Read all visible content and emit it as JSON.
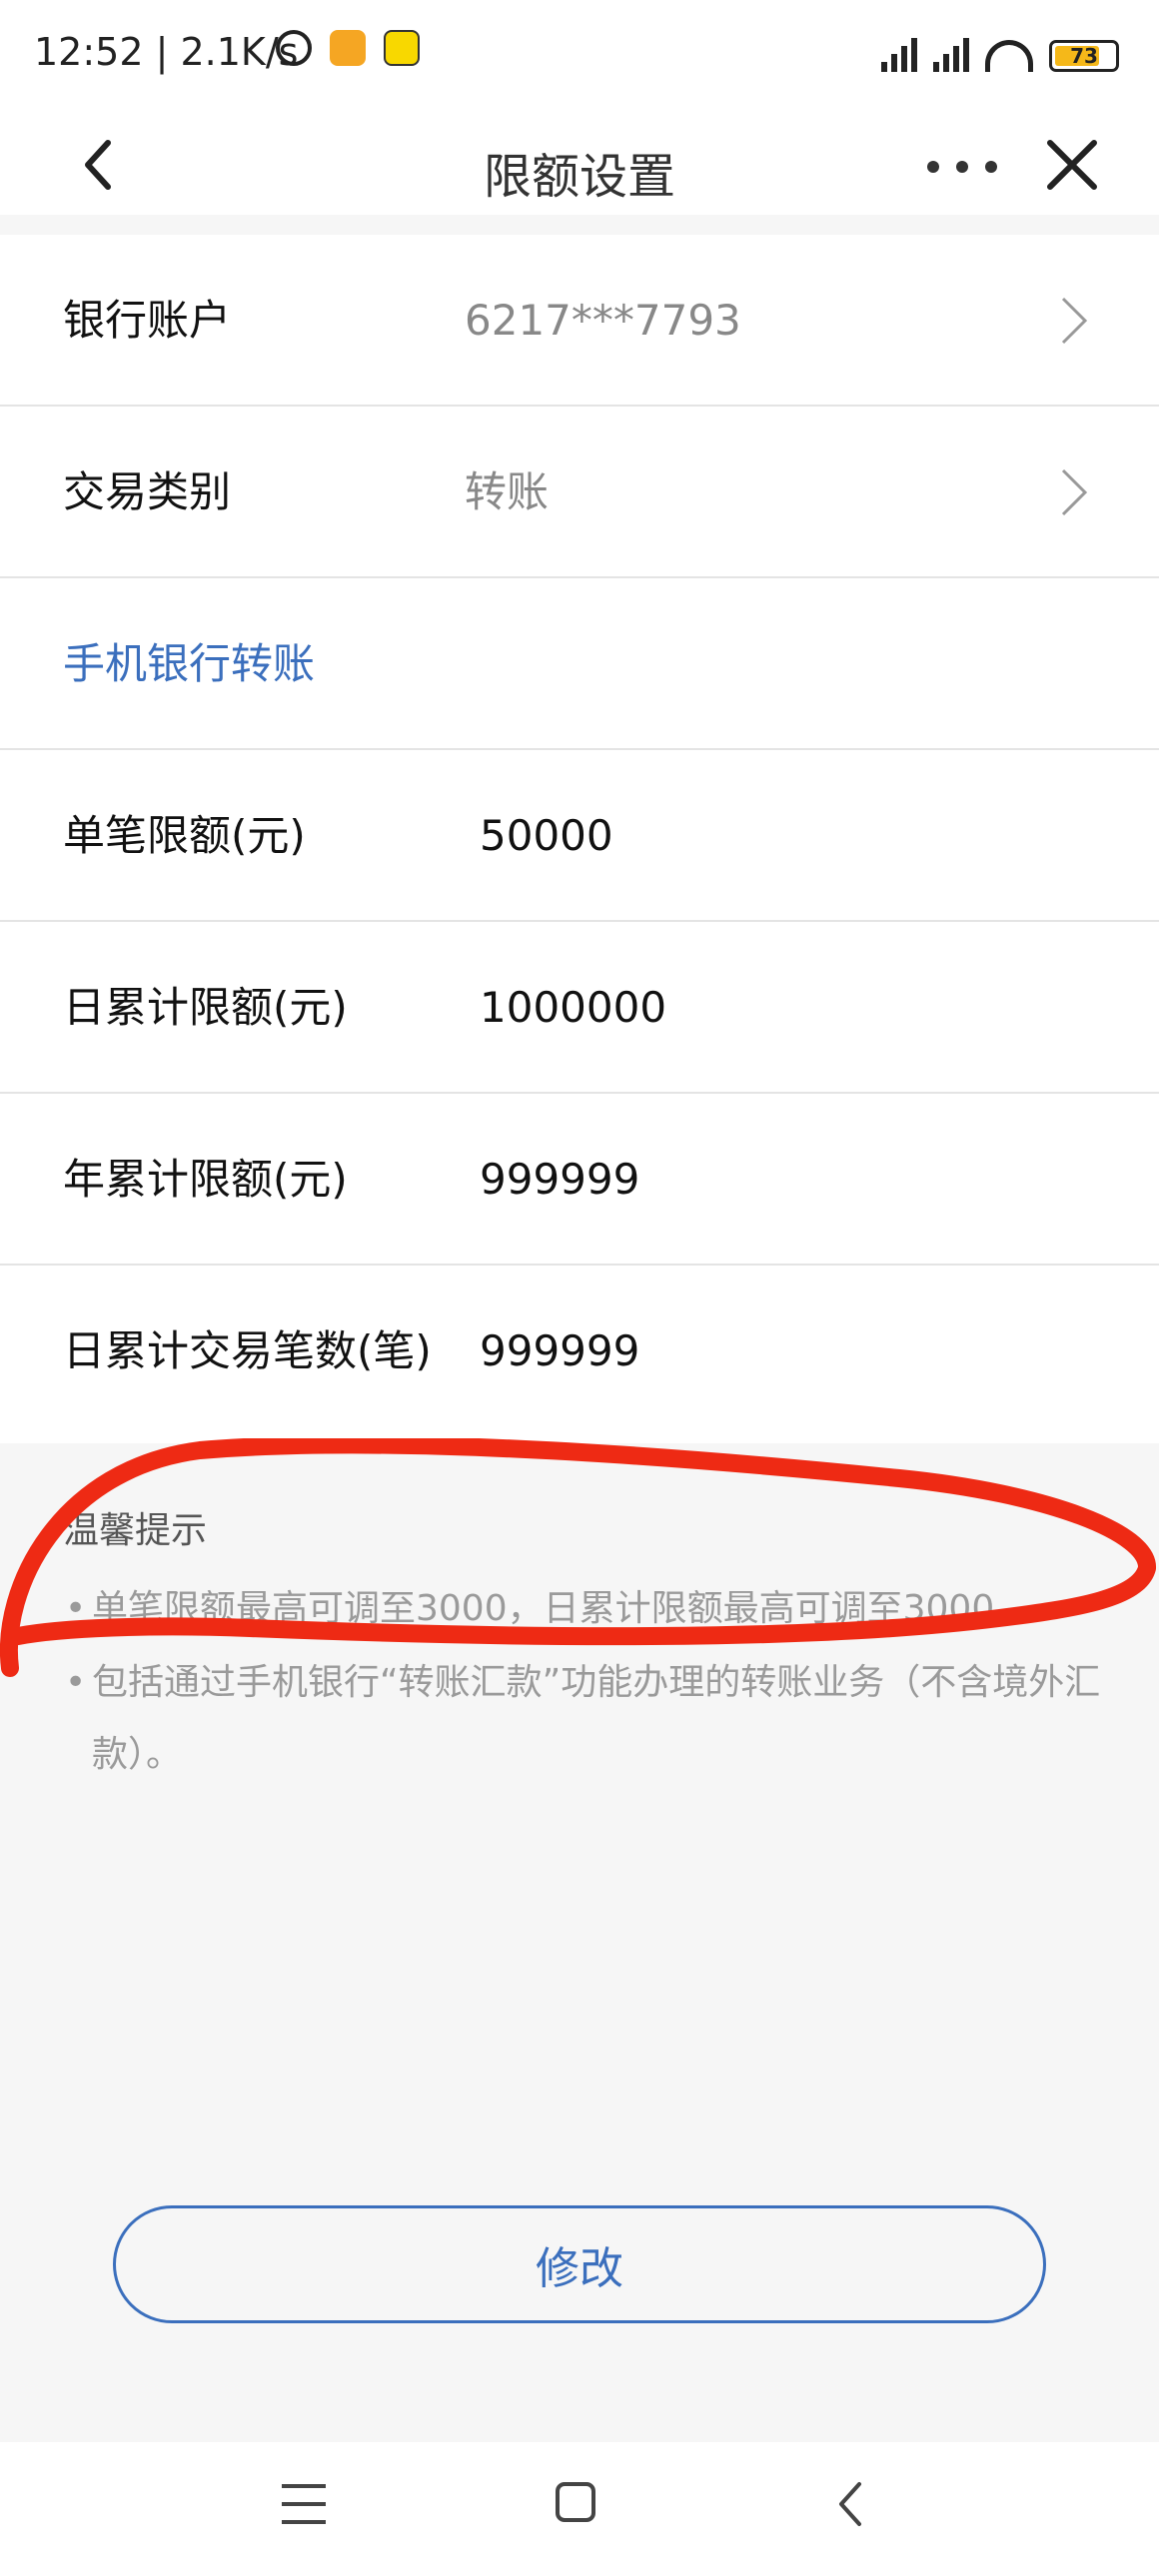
{
  "status_bar": {
    "time": "12:52",
    "net_speed": "2.1K/s",
    "battery": "73",
    "icons": [
      "alarm-icon",
      "app-icon",
      "app-icon",
      "signal-icon",
      "signal-icon",
      "wifi-icon",
      "battery-icon"
    ]
  },
  "nav": {
    "title": "限额设置",
    "icons": [
      "back-icon",
      "more-icon",
      "close-icon"
    ]
  },
  "rows": {
    "account_label": "银行账户",
    "account_value": "6217***7793",
    "type_label": "交易类别",
    "type_value": "转账",
    "section_title": "手机银行转账",
    "limits": [
      {
        "label": "单笔限额(元)",
        "value": "50000"
      },
      {
        "label": "日累计限额(元)",
        "value": "1000000"
      },
      {
        "label": "年累计限额(元)",
        "value": "999999"
      },
      {
        "label": "日累计交易笔数(笔)",
        "value": "999999"
      }
    ]
  },
  "tips": {
    "title": "温馨提示",
    "bullet": "•",
    "items": [
      "单笔限额最高可调至3000，日累计限额最高可调至3000",
      "包括通过手机银行“转账汇款”功能办理的转账业务（不含境外汇款）。"
    ]
  },
  "modify_label": "修改",
  "colors": {
    "accent": "#3b6fbd",
    "annotation": "#ee2a14",
    "background": "#f6f6f6"
  }
}
